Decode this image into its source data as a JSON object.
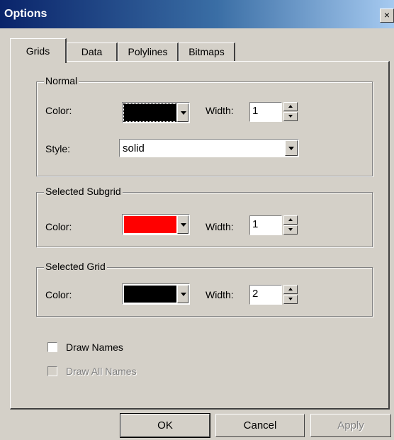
{
  "window": {
    "title": "Options",
    "close_glyph": "×"
  },
  "tabs": [
    {
      "label": "Grids",
      "active": true
    },
    {
      "label": "Data",
      "active": false
    },
    {
      "label": "Polylines",
      "active": false
    },
    {
      "label": "Bitmaps",
      "active": false
    }
  ],
  "normal": {
    "legend": "Normal",
    "color_label": "Color:",
    "color_value": "#000000",
    "width_label": "Width:",
    "width_value": "1",
    "style_label": "Style:",
    "style_value": "solid"
  },
  "selected_subgrid": {
    "legend": "Selected Subgrid",
    "color_label": "Color:",
    "color_value": "#ff0000",
    "width_label": "Width:",
    "width_value": "1"
  },
  "selected_grid": {
    "legend": "Selected Grid",
    "color_label": "Color:",
    "color_value": "#000000",
    "width_label": "Width:",
    "width_value": "2"
  },
  "checkboxes": {
    "draw_names": {
      "label": "Draw Names",
      "checked": false,
      "enabled": true
    },
    "draw_all_names": {
      "label": "Draw All Names",
      "checked": false,
      "enabled": false
    }
  },
  "buttons": {
    "ok": "OK",
    "cancel": "Cancel",
    "apply": "Apply"
  }
}
